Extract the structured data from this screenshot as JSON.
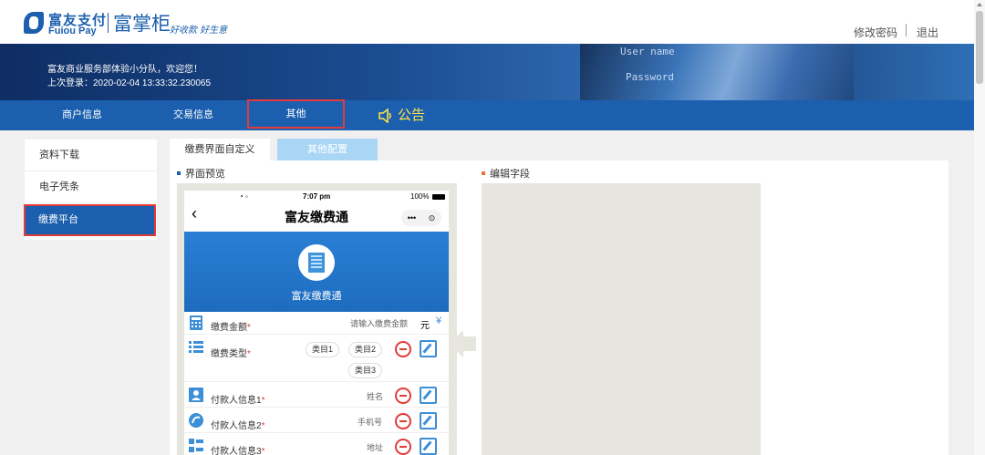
{
  "header": {
    "logo_cn": "富友支付",
    "logo_en": "Fuiou Pay",
    "brand": "富掌柜",
    "slogan": "好收款 好生意",
    "change_password": "修改密码",
    "logout": "退出"
  },
  "banner": {
    "welcome": "富友商业服务部体验小分队，欢迎您！",
    "last_login": "上次登录：2020-02-04 13:33:32.230065",
    "art_text_1": "User name",
    "art_text_2": "Password"
  },
  "nav": {
    "items": [
      {
        "label": "商户信息",
        "active": false
      },
      {
        "label": "交易信息",
        "active": false
      },
      {
        "label": "其他",
        "active": true
      }
    ],
    "notice": "公告"
  },
  "sidebar": {
    "items": [
      {
        "label": "资料下载",
        "active": false
      },
      {
        "label": "电子凭条",
        "active": false
      },
      {
        "label": "缴费平台",
        "active": true
      }
    ]
  },
  "tabs": [
    {
      "label": "缴费界面自定义",
      "active": true
    },
    {
      "label": "其他配置",
      "active": false
    }
  ],
  "sections": {
    "preview": "界面预览",
    "edit": "编辑字段"
  },
  "phone": {
    "time": "7:07 pm",
    "battery": "100%",
    "title": "富友缴费通",
    "banner_text": "富友缴费通",
    "rows": [
      {
        "label": "缴费金额",
        "placeholder": "请输入缴费金额",
        "unit": "元",
        "currency": "¥"
      },
      {
        "label": "缴费类型",
        "chips": [
          "类目1",
          "类目2",
          "类目3"
        ]
      },
      {
        "label": "付款人信息1",
        "placeholder": "姓名"
      },
      {
        "label": "付款人信息2",
        "placeholder": "手机号"
      },
      {
        "label": "付款人信息3",
        "placeholder": "地址"
      }
    ]
  },
  "colors": {
    "brand_blue": "#1b5fae",
    "highlight_red": "#e23b3b",
    "notice_yellow": "#ffe14a",
    "inactive_tab": "#a9d6f5"
  }
}
